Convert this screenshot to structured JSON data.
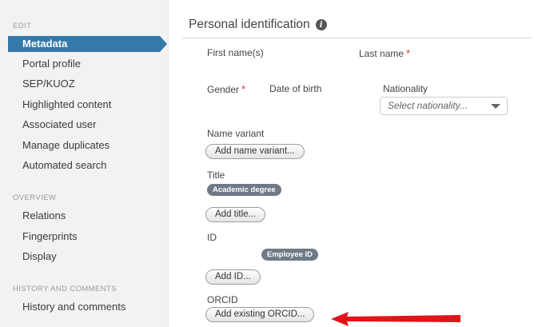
{
  "sidebar": {
    "edit_heading": "EDIT",
    "edit_items": [
      {
        "label": "Metadata"
      },
      {
        "label": "Portal profile"
      },
      {
        "label": "SEP/KUOZ"
      },
      {
        "label": "Highlighted content"
      },
      {
        "label": "Associated user"
      },
      {
        "label": "Manage duplicates"
      },
      {
        "label": "Automated search"
      }
    ],
    "overview_heading": "OVERVIEW",
    "overview_items": [
      {
        "label": "Relations"
      },
      {
        "label": "Fingerprints"
      },
      {
        "label": "Display"
      }
    ],
    "history_heading": "HISTORY AND COMMENTS",
    "history_items": [
      {
        "label": "History and comments"
      }
    ],
    "active_color": "#3579a9"
  },
  "main": {
    "section_title": "Personal identification",
    "info_icon": "i",
    "fields": {
      "first_name": "First name(s)",
      "last_name": "Last name",
      "gender": "Gender",
      "date_of_birth": "Date of birth",
      "nationality": "Nationality",
      "nationality_placeholder": "Select nationality...",
      "required_mark": "*",
      "name_variant": "Name variant",
      "add_name_variant": "Add name variant...",
      "title": "Title",
      "title_badge": "Academic degree",
      "add_title": "Add title...",
      "id": "ID",
      "id_badge": "Employee ID",
      "add_id": "Add ID...",
      "orcid": "ORCID",
      "add_orcid": "Add existing ORCID..."
    },
    "annotation_arrow_color": "#e0141a",
    "required_color": "#d9342b"
  }
}
